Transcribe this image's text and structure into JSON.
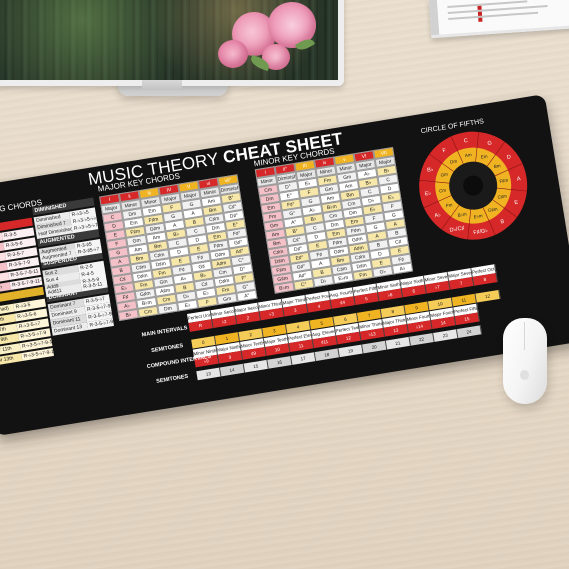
{
  "mat": {
    "title_main": "MUSIC THEORY",
    "title_emph": "CHEAT SHEET",
    "building_chords": "BUILDING CHORDS",
    "major_key_chords": "MAJOR KEY CHORDS",
    "minor_key_chords": "MINOR KEY CHORDS",
    "circle_of_fifths": "CIRCLE OF FIFTHS",
    "perfect_fifth": "PERFECT 5TH INTERVALS",
    "perfect_fourth": "PERFECT 4TH INTERVALS",
    "main_intervals": "MAIN INTERVALS",
    "semitones": "SEMITONES",
    "compound_intervals": "COMPOUND INTERVALS",
    "semitones_2": "SEMITONES"
  },
  "build": {
    "sections": [
      {
        "label": "MAJOR",
        "color": "#d62828"
      },
      {
        "label": "DIMINISHED",
        "color": "#3a3a3a"
      },
      {
        "label": "AUGMENTED",
        "color": "#3a3a3a"
      },
      {
        "label": "SUSPENDED",
        "color": "#3a3a3a"
      },
      {
        "label": "MINOR",
        "color": "#e2b12a"
      },
      {
        "label": "DOMINANT",
        "color": "#3a3a3a"
      }
    ],
    "left_rows": [
      {
        "name": "(triad)",
        "formula": "R-3-5"
      },
      {
        "name": "jor 6th",
        "formula": "R-3-5-6"
      },
      {
        "name": "r 7th",
        "formula": "R-3-5-7"
      },
      {
        "name": "jor 9th",
        "formula": "R-3-5-7-9"
      },
      {
        "name": "Major 11th",
        "formula": "R-3-5-7-9-11"
      },
      {
        "name": "Major 13th",
        "formula": "R-3-5-7-9-11-13"
      },
      {
        "name": "Minor (triad)",
        "formula": "R-♭3-5"
      },
      {
        "name": "Minor 6th",
        "formula": "R-♭3-5-6"
      },
      {
        "name": "Minor 7th",
        "formula": "R-♭3-5-♭7"
      },
      {
        "name": "Minor 9th",
        "formula": "R-♭3-5-♭7-9"
      },
      {
        "name": "Minor 11th",
        "formula": "R-♭3-5-♭7-9-11"
      },
      {
        "name": "Minor 13th",
        "formula": "R-♭3-5-♭7-9-11-13"
      }
    ],
    "right_rows": [
      {
        "name": "Diminished",
        "formula": "R-♭3-♭5"
      },
      {
        "name": "Diminished 7",
        "formula": "R-♭3-♭5-♭♭7"
      },
      {
        "name": "Half Diminished 7",
        "formula": "R-♭3-♭5-♭7"
      },
      {
        "name": "Augmented",
        "formula": "R-3-♯5"
      },
      {
        "name": "Augmented 7",
        "formula": "R-3-♯5-♭7"
      },
      {
        "name": "Sus 2",
        "formula": "R-2-5"
      },
      {
        "name": "Sus 4",
        "formula": "R-4-5"
      },
      {
        "name": "Add9",
        "formula": "R-3-5-9"
      },
      {
        "name": "Add11",
        "formula": "R-3-5-11"
      },
      {
        "name": "Dominant 7",
        "formula": "R-3-5-♭7"
      },
      {
        "name": "Dominant 9",
        "formula": "R-3-5-♭7-9"
      },
      {
        "name": "Dominant 11",
        "formula": "R-3-5-♭7-9-11"
      },
      {
        "name": "Dominant 13",
        "formula": "R-3-5-♭7-9-11-13"
      }
    ]
  },
  "major_grid": {
    "header": [
      "I",
      "ii",
      "iii",
      "IV",
      "V",
      "vi",
      "vii°"
    ],
    "subheader": [
      "Major",
      "Minor",
      "Minor",
      "Major",
      "Major",
      "Minor",
      "Diminished"
    ],
    "rows": [
      [
        "C",
        "Dm",
        "Em",
        "F",
        "G",
        "Am",
        "B°"
      ],
      [
        "D",
        "Em",
        "F♯m",
        "G",
        "A",
        "Bm",
        "C♯°"
      ],
      [
        "E",
        "F♯m",
        "G♯m",
        "A",
        "B",
        "C♯m",
        "D♯°"
      ],
      [
        "F",
        "Gm",
        "Am",
        "B♭",
        "C",
        "Dm",
        "E°"
      ],
      [
        "G",
        "Am",
        "Bm",
        "C",
        "D",
        "Em",
        "F♯°"
      ],
      [
        "A",
        "Bm",
        "C♯m",
        "D",
        "E",
        "F♯m",
        "G♯°"
      ],
      [
        "B",
        "C♯m",
        "D♯m",
        "E",
        "F♯",
        "G♯m",
        "A♯°"
      ],
      [
        "C♯",
        "D♯m",
        "Fm",
        "F♯",
        "G♯",
        "A♯m",
        "C°"
      ],
      [
        "E♭",
        "Fm",
        "Gm",
        "A♭",
        "B♭",
        "Cm",
        "D°"
      ],
      [
        "F♯",
        "G♯m",
        "A♯m",
        "B",
        "C♯",
        "D♯m",
        "F°"
      ],
      [
        "A♭",
        "B♭m",
        "Cm",
        "D♭",
        "E♭",
        "Fm",
        "G°"
      ],
      [
        "B♭",
        "Cm",
        "Dm",
        "E♭",
        "F",
        "Gm",
        "A°"
      ]
    ]
  },
  "minor_grid": {
    "header": [
      "i",
      "ii°",
      "III",
      "iv",
      "v",
      "VI",
      "VII"
    ],
    "subheader": [
      "Minor",
      "Diminished",
      "Major",
      "Minor",
      "Minor",
      "Major",
      "Major"
    ],
    "rows": [
      [
        "Cm",
        "D°",
        "E♭",
        "Fm",
        "Gm",
        "A♭",
        "B♭"
      ],
      [
        "Dm",
        "E°",
        "F",
        "Gm",
        "Am",
        "B♭",
        "C"
      ],
      [
        "Em",
        "F♯°",
        "G",
        "Am",
        "Bm",
        "C",
        "D"
      ],
      [
        "Fm",
        "G°",
        "A♭",
        "B♭m",
        "Cm",
        "D♭",
        "E♭"
      ],
      [
        "Gm",
        "A°",
        "B♭",
        "Cm",
        "Dm",
        "E♭",
        "F"
      ],
      [
        "Am",
        "B°",
        "C",
        "Dm",
        "Em",
        "F",
        "G"
      ],
      [
        "Bm",
        "C♯°",
        "D",
        "Em",
        "F♯m",
        "G",
        "A"
      ],
      [
        "C♯m",
        "D♯°",
        "E",
        "F♯m",
        "G♯m",
        "A",
        "B"
      ],
      [
        "D♯m",
        "E♯°",
        "F♯",
        "G♯m",
        "A♯m",
        "B",
        "C♯"
      ],
      [
        "F♯m",
        "G♯°",
        "A",
        "Bm",
        "C♯m",
        "D",
        "E"
      ],
      [
        "G♯m",
        "A♯°",
        "B",
        "C♯m",
        "D♯m",
        "E",
        "F♯"
      ],
      [
        "B♭m",
        "C°",
        "D♭",
        "E♭m",
        "Fm",
        "G♭",
        "A♭"
      ]
    ]
  },
  "intervals": {
    "names": [
      "Perfect Unison",
      "Minor Second",
      "Major Second",
      "Minor Third",
      "Major Third",
      "Perfect Fourth",
      "Aug. Fourth / Dim. Fifth",
      "Perfect Fifth",
      "Minor Sixth",
      "Major Sixth",
      "Minor Seventh",
      "Major Seventh",
      "Perfect Octave"
    ],
    "symbols": [
      "R",
      "♭2",
      "2",
      "♭3",
      "3",
      "4",
      "♯4",
      "5",
      "♭6",
      "6",
      "♭7",
      "7",
      "8"
    ],
    "semitones": [
      "0",
      "1",
      "2",
      "3",
      "4",
      "5",
      "6",
      "7",
      "8",
      "9",
      "10",
      "11",
      "12"
    ],
    "compound_names": [
      "Minor Ninth",
      "Major Ninth",
      "Minor Tenth",
      "Major Tenth",
      "Perfect Eleventh",
      "Aug. Eleventh",
      "Perfect Twelfth",
      "Minor Thirteenth",
      "Major Thirteenth",
      "Minor Fourteenth",
      "Major Fourteenth",
      "Perfect Fifteenth"
    ],
    "compound_symbols": [
      "♭9",
      "9",
      "♯9",
      "10",
      "11",
      "♯11",
      "12",
      "♭13",
      "13",
      "♭14",
      "14",
      "15"
    ],
    "compound_semitones": [
      "13",
      "14",
      "15",
      "16",
      "17",
      "18",
      "19",
      "20",
      "21",
      "22",
      "23",
      "24"
    ]
  },
  "circle": {
    "outer": [
      "C",
      "G",
      "D",
      "A",
      "E",
      "B",
      "F♯/G♭",
      "D♭/C♯",
      "A♭",
      "E♭",
      "B♭",
      "F"
    ],
    "inner": [
      "Am",
      "Em",
      "Bm",
      "F♯m",
      "C♯m",
      "G♯m",
      "E♭m",
      "B♭m",
      "Fm",
      "Cm",
      "Gm",
      "Dm"
    ],
    "center_label": "MAJOR KEYS",
    "minor_label": "MINOR KEYS"
  },
  "colors": {
    "red": "#d62828",
    "yellow": "#f0b423",
    "pink": "#f4c1c8",
    "light_yellow": "#f7e7a8",
    "gray": "#dcdcdc",
    "black": "#121212"
  }
}
